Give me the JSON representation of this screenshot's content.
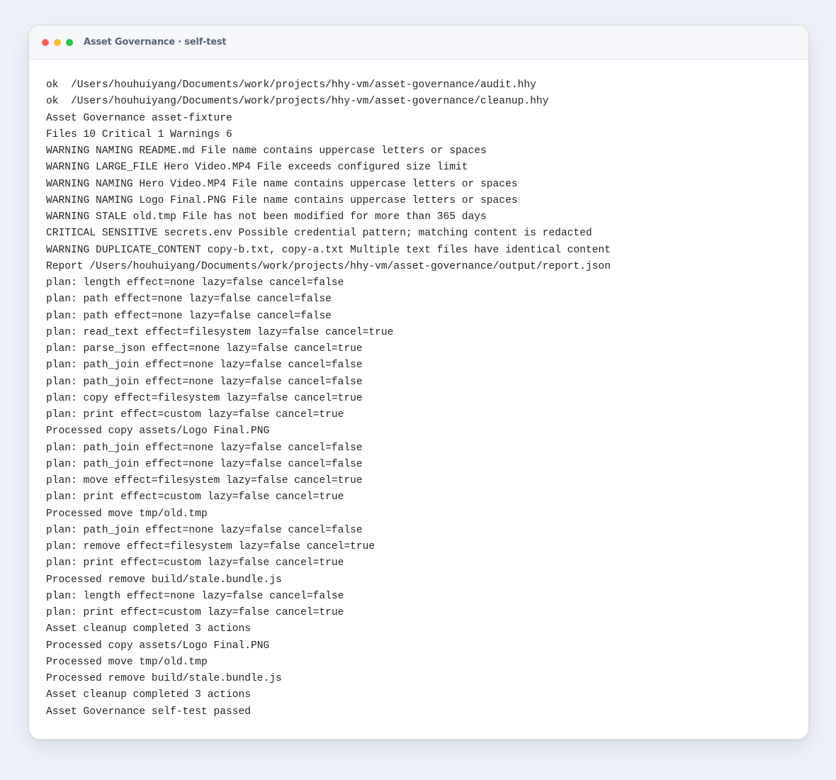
{
  "window": {
    "title": "Asset Governance · self-test",
    "controls": {
      "close_color": "#ff5f57",
      "minimize_color": "#febc2e",
      "zoom_color": "#28c840"
    }
  },
  "console": {
    "lines": [
      "ok  /Users/houhuiyang/Documents/work/projects/hhy-vm/asset-governance/audit.hhy",
      "ok  /Users/houhuiyang/Documents/work/projects/hhy-vm/asset-governance/cleanup.hhy",
      "Asset Governance asset-fixture",
      "Files 10 Critical 1 Warnings 6",
      "WARNING NAMING README.md File name contains uppercase letters or spaces",
      "WARNING LARGE_FILE Hero Video.MP4 File exceeds configured size limit",
      "WARNING NAMING Hero Video.MP4 File name contains uppercase letters or spaces",
      "WARNING NAMING Logo Final.PNG File name contains uppercase letters or spaces",
      "WARNING STALE old.tmp File has not been modified for more than 365 days",
      "CRITICAL SENSITIVE secrets.env Possible credential pattern; matching content is redacted",
      "WARNING DUPLICATE_CONTENT copy-b.txt, copy-a.txt Multiple text files have identical content",
      "Report /Users/houhuiyang/Documents/work/projects/hhy-vm/asset-governance/output/report.json",
      "plan: length effect=none lazy=false cancel=false",
      "plan: path effect=none lazy=false cancel=false",
      "plan: path effect=none lazy=false cancel=false",
      "plan: read_text effect=filesystem lazy=false cancel=true",
      "plan: parse_json effect=none lazy=false cancel=true",
      "plan: path_join effect=none lazy=false cancel=false",
      "plan: path_join effect=none lazy=false cancel=false",
      "plan: copy effect=filesystem lazy=false cancel=true",
      "plan: print effect=custom lazy=false cancel=true",
      "Processed copy assets/Logo Final.PNG",
      "plan: path_join effect=none lazy=false cancel=false",
      "plan: path_join effect=none lazy=false cancel=false",
      "plan: move effect=filesystem lazy=false cancel=true",
      "plan: print effect=custom lazy=false cancel=true",
      "Processed move tmp/old.tmp",
      "plan: path_join effect=none lazy=false cancel=false",
      "plan: remove effect=filesystem lazy=false cancel=true",
      "plan: print effect=custom lazy=false cancel=true",
      "Processed remove build/stale.bundle.js",
      "plan: length effect=none lazy=false cancel=false",
      "plan: print effect=custom lazy=false cancel=true",
      "Asset cleanup completed 3 actions",
      "Processed copy assets/Logo Final.PNG",
      "Processed move tmp/old.tmp",
      "Processed remove build/stale.bundle.js",
      "Asset cleanup completed 3 actions",
      "Asset Governance self-test passed"
    ]
  }
}
